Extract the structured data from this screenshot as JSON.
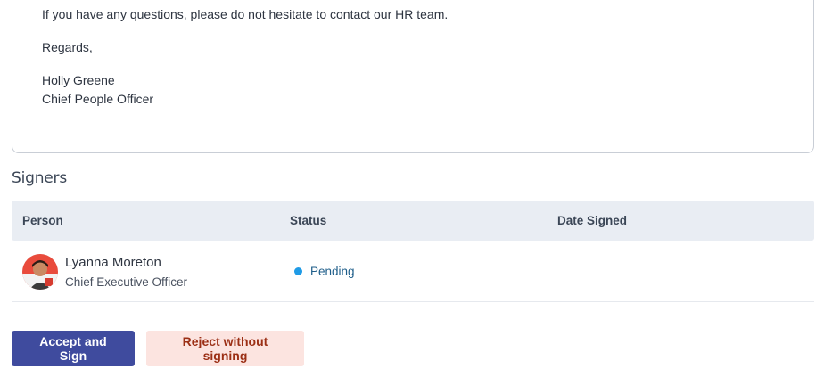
{
  "document": {
    "lines": [
      "If you have any questions, please do not hesitate to contact our HR team.",
      "Regards,",
      "Holly Greene",
      "Chief People Officer"
    ]
  },
  "signers": {
    "title": "Signers",
    "columns": [
      "Person",
      "Status",
      "Date Signed"
    ],
    "rows": [
      {
        "avatar": "avatar-photo",
        "name": "Lyanna Moreton",
        "role": "Chief Executive Officer",
        "status": "Pending",
        "status_color": "#1f9be6",
        "date_signed": ""
      }
    ]
  },
  "actions": {
    "accept_label": "Accept and Sign",
    "reject_label": "Reject without signing",
    "accept_color": "#3f4b9e",
    "reject_color": "#fce4e0"
  }
}
